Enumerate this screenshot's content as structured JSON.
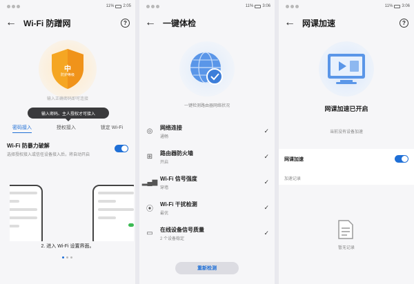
{
  "screen1": {
    "status_time": "2:05",
    "status_battery": "11%",
    "title": "Wi-Fi 防蹭网",
    "shield_char": "中",
    "shield_sub": "防护等级",
    "faded_text": "输入正确密码即可连接",
    "tooltip": "输入密码、主人授权才可接入",
    "tabs": [
      "密码接入",
      "授权接入",
      "锁定 Wi-Fi"
    ],
    "setting_label": "Wi-Fi 防暴力破解",
    "setting_desc": "选择授权接入或信任设备接入后，将自动开启",
    "setting_on": true,
    "caption": "2. 进入 Wi-Fi 设置界面。"
  },
  "screen2": {
    "status_time": "3:06",
    "status_battery": "11%",
    "title": "一键体检",
    "subtitle": "一键检测路由器网络状况",
    "items": [
      {
        "icon": "globe-icon",
        "title": "网络连接",
        "status": "通畅"
      },
      {
        "icon": "firewall-icon",
        "title": "路由器防火墙",
        "status": "开启"
      },
      {
        "icon": "signal-icon",
        "title": "Wi-Fi 信号强度",
        "status": "穿墙"
      },
      {
        "icon": "interference-icon",
        "title": "Wi-Fi 干扰检测",
        "status": "最优"
      },
      {
        "icon": "devices-icon",
        "title": "在线设备信号质量",
        "status": "2 个设备稳定"
      }
    ],
    "recheck_label": "重新检测"
  },
  "screen3": {
    "status_time": "3:06",
    "status_battery": "11%",
    "title": "网课加速",
    "status_text": "网课加速已开启",
    "note": "当前没有设备加速",
    "toggle_label": "网课加速",
    "toggle_on": true,
    "records_label": "加速记录",
    "empty_text": "暂无记录"
  },
  "colors": {
    "accent": "#1f6fd6",
    "shield": "#f5a623",
    "background": "#f6f6f8",
    "tooltip": "#3a3a3c"
  }
}
